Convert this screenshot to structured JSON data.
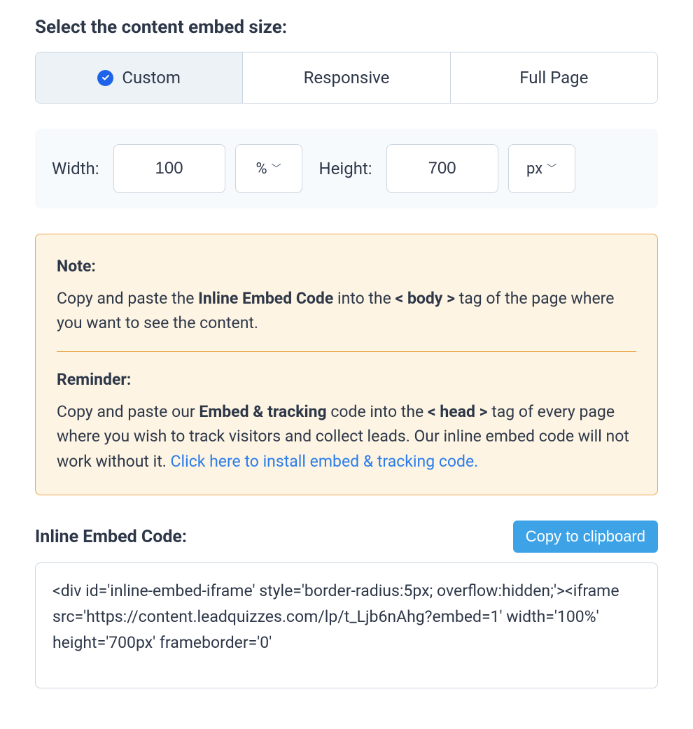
{
  "heading": "Select the content embed size:",
  "tabs": {
    "custom": "Custom",
    "responsive": "Responsive",
    "fullpage": "Full Page"
  },
  "size": {
    "width_label": "Width:",
    "width_value": "100",
    "width_unit": "%",
    "height_label": "Height:",
    "height_value": "700",
    "height_unit": "px"
  },
  "note": {
    "note_title": "Note:",
    "note_pre": "Copy and paste the ",
    "note_bold1": "Inline Embed Code",
    "note_mid1": " into the ",
    "note_bold2": "< body >",
    "note_post": " tag of the page where you want to see the content.",
    "rem_title": "Reminder:",
    "rem_pre": "Copy and paste our ",
    "rem_bold1": "Embed & tracking",
    "rem_mid1": " code into the ",
    "rem_bold2": "< head >",
    "rem_post": " tag of every page where you wish to track visitors and collect leads. Our inline embed code will not work without it. ",
    "rem_link": "Click here to install embed & tracking code."
  },
  "embed": {
    "title": "Inline Embed Code:",
    "copy_btn": "Copy to clipboard",
    "code": "<div id='inline-embed-iframe' style='border-radius:5px; overflow:hidden;'><iframe src='https://content.leadquizzes.com/lp/t_Ljb6nAhg?embed=1' width='100%' height='700px' frameborder='0'"
  }
}
